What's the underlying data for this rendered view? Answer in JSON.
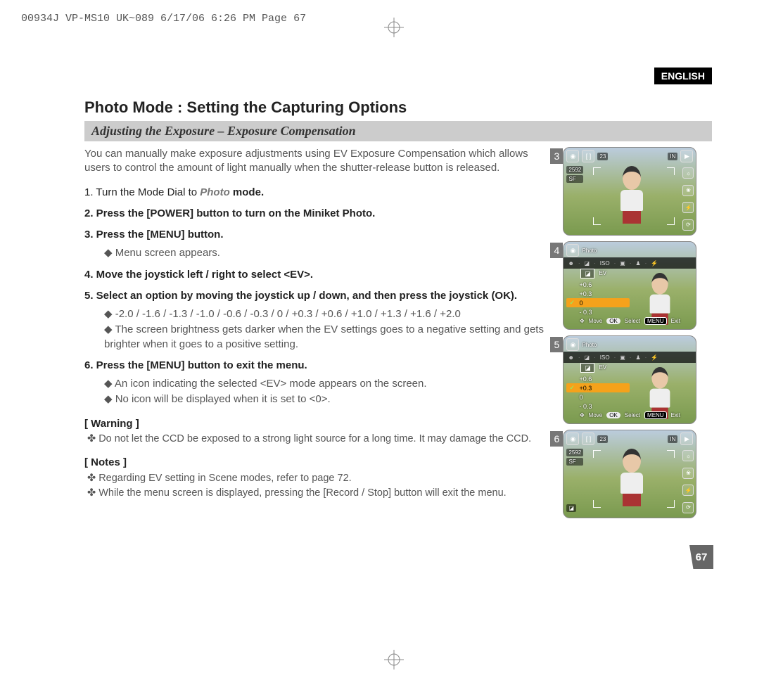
{
  "print_header": "00934J VP-MS10 UK~089  6/17/06 6:26 PM  Page 67",
  "language_badge": "ENGLISH",
  "title": "Photo Mode : Setting the Capturing Options",
  "subheading": "Adjusting the Exposure – Exposure Compensation",
  "intro": "You can manually make exposure adjustments using EV Exposure Compensation which allows users to control the amount of light manually when the shutter-release button is released.",
  "steps": {
    "s1_pre": "1. Turn the Mode Dial to ",
    "s1_mode": "Photo",
    "s1_post": " mode.",
    "s2": "2. Press the [POWER] button to turn on the Miniket Photo.",
    "s3": "3. Press the [MENU] button.",
    "s3_b1": "Menu screen appears.",
    "s4": "4. Move the joystick left / right to select <EV>.",
    "s5": "5. Select an option by moving the joystick up / down, and then press the joystick (OK).",
    "s5_b1": "-2.0 / -1.6 / -1.3 / -1.0 / -0.6 / -0.3 / 0 / +0.3 / +0.6 / +1.0 / +1.3 / +1.6 / +2.0",
    "s5_b2": "The screen brightness gets darker when the EV settings goes to a negative setting and gets brighter when it goes to a positive setting.",
    "s6": "6. Press the [MENU] button to exit the menu.",
    "s6_b1": "An icon indicating the selected <EV> mode appears on the screen.",
    "s6_b2": "No icon will be displayed when it is set to <0>."
  },
  "warning_h": "[ Warning ]",
  "warning_1": "Do not let the CCD be exposed to a strong light source for a long time. It may damage the CCD.",
  "notes_h": "[ Notes ]",
  "notes_1": "Regarding EV setting in Scene modes, refer to page 72.",
  "notes_2": "While the menu screen is displayed, pressing the [Record / Stop] button will exit the menu.",
  "page_number": "67",
  "shots": {
    "labels": {
      "n3": "3",
      "n4": "4",
      "n5": "5",
      "n6": "6"
    },
    "live": {
      "res": "2592",
      "sf": "SF",
      "count": "23",
      "storage": "IN"
    },
    "menu": {
      "mode": "Photo",
      "iso": "ISO",
      "tab": "EV",
      "hints_move": "Move",
      "hints_ok": "OK",
      "hints_select": "Select",
      "hints_menu": "MENU",
      "hints_exit": "Exit"
    },
    "ev4": {
      "r1": "+0.6",
      "r2": "+0.3",
      "r3": "0",
      "r4": "- 0.3"
    },
    "ev5": {
      "r1": "+0.6",
      "r2": "+0.3",
      "r3": "0",
      "r4": "- 0.3"
    }
  }
}
